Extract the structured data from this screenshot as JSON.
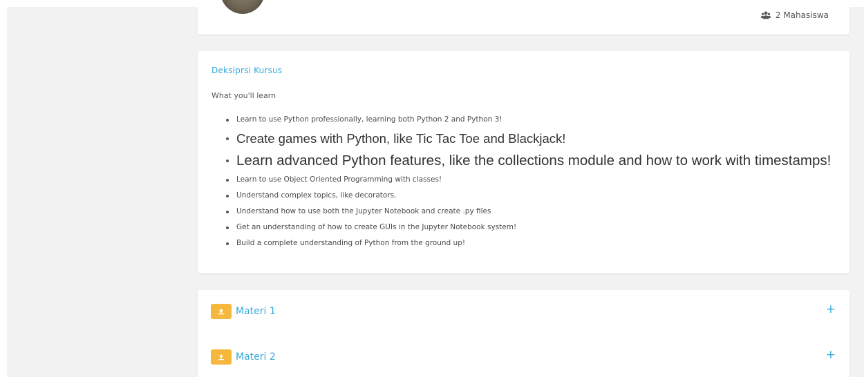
{
  "header_card": {
    "students_count_label": "2 Mahasiswa",
    "students_icon": "users-icon",
    "avatar_icon": "avatar"
  },
  "description": {
    "title": "Deksiprsi Kursus",
    "subtitle": "What you'll learn",
    "items": [
      {
        "text": "Learn to use Python professionally, learning both Python 2 and Python 3!"
      },
      {
        "text": "Create games with Python, like Tic Tac Toe and Blackjack!"
      },
      {
        "text": "Learn advanced Python features, like the collections module and how to work with timestamps!"
      },
      {
        "text": "Learn to use Object Oriented Programming with classes!"
      },
      {
        "text": "Understand complex topics, like decorators."
      },
      {
        "text": "Understand how to use both the Jupyter Notebook and create .py files"
      },
      {
        "text": "Get an understanding of how to create GUIs in the Jupyter Notebook system!"
      },
      {
        "text": "Build a complete understanding of Python from the ground up!"
      }
    ]
  },
  "materials": [
    {
      "label": "Materi 1",
      "toggle": "+",
      "icon": "upload-icon"
    },
    {
      "label": "Materi 2",
      "toggle": "+",
      "icon": "upload-icon"
    }
  ],
  "colors": {
    "accent": "#36a9d7",
    "badge": "#f5b83d",
    "page_background": "#f2f2f2",
    "card_background": "#ffffff"
  }
}
